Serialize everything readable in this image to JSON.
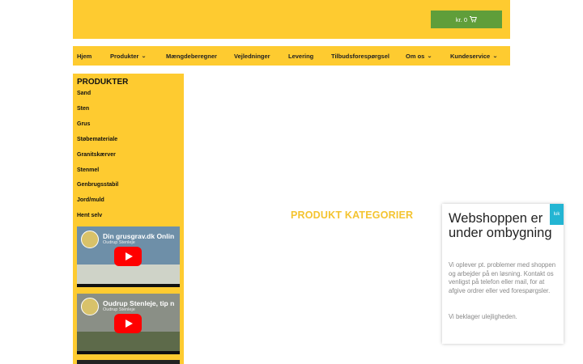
{
  "header": {
    "cart_label": "kr. 0",
    "cart_icon": "shopping-cart-icon"
  },
  "nav": {
    "items": [
      {
        "label": "Hjem",
        "dropdown": false
      },
      {
        "label": "Produkter",
        "dropdown": true
      },
      {
        "label": "Mængdeberegner",
        "dropdown": false
      },
      {
        "label": "Vejledninger",
        "dropdown": false
      },
      {
        "label": "Levering",
        "dropdown": false
      },
      {
        "label": "Tilbudsforespørgsel",
        "dropdown": false
      },
      {
        "label": "Om os",
        "dropdown": true
      },
      {
        "label": "Kundeservice",
        "dropdown": true
      }
    ],
    "chevron": "⌄"
  },
  "sidebar": {
    "title": "PRODUKTER",
    "links": [
      "Sand",
      "Sten",
      "Grus",
      "Støbemateriale",
      "Granitskærver",
      "Stenmel",
      "Genbrugsstabil",
      "Jord/muld",
      "Hent selv"
    ],
    "videos": [
      {
        "title": "Din grusgrav.dk Onlin",
        "channel": "Oudrup Stenleje"
      },
      {
        "title": "Oudrup Stenleje, tip n",
        "channel": "Oudrup Stenleje"
      }
    ]
  },
  "main": {
    "heading": "PRODUKT KATEGORIER"
  },
  "popup": {
    "title": "Webshoppen er under ombygning",
    "body": "Vi oplever pt. problemer med shoppen og arbejder på en løsning. Kontakt os venligst på telefon eller mail, for at afgive ordrer eller ved forespørgsler.",
    "note": "Vi beklager ulejligheden.",
    "close_label": "luk"
  },
  "colors": {
    "brand_yellow": "#fecb30",
    "cart_green": "#5f9e3a",
    "heading_yellow": "#f4c430",
    "close_cyan": "#23b5d3"
  }
}
